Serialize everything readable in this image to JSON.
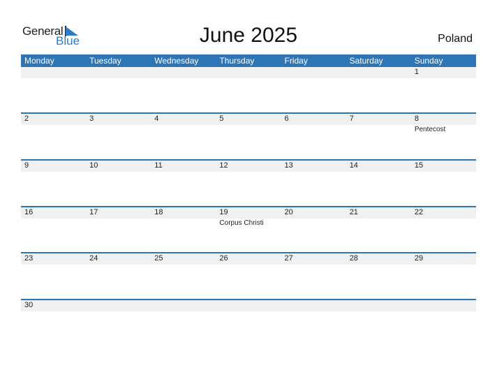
{
  "logo": {
    "text1": "General",
    "text2": "Blue"
  },
  "title": "June 2025",
  "country": "Poland",
  "colors": {
    "accent": "#2e75b6",
    "strip": "#f0f0f0"
  },
  "weekdays": [
    "Monday",
    "Tuesday",
    "Wednesday",
    "Thursday",
    "Friday",
    "Saturday",
    "Sunday"
  ],
  "weeks": [
    [
      {
        "d": ""
      },
      {
        "d": ""
      },
      {
        "d": ""
      },
      {
        "d": ""
      },
      {
        "d": ""
      },
      {
        "d": ""
      },
      {
        "d": "1"
      }
    ],
    [
      {
        "d": "2"
      },
      {
        "d": "3"
      },
      {
        "d": "4"
      },
      {
        "d": "5"
      },
      {
        "d": "6"
      },
      {
        "d": "7"
      },
      {
        "d": "8",
        "e": "Pentecost"
      }
    ],
    [
      {
        "d": "9"
      },
      {
        "d": "10"
      },
      {
        "d": "11"
      },
      {
        "d": "12"
      },
      {
        "d": "13"
      },
      {
        "d": "14"
      },
      {
        "d": "15"
      }
    ],
    [
      {
        "d": "16"
      },
      {
        "d": "17"
      },
      {
        "d": "18"
      },
      {
        "d": "19",
        "e": "Corpus Christi"
      },
      {
        "d": "20"
      },
      {
        "d": "21"
      },
      {
        "d": "22"
      }
    ],
    [
      {
        "d": "23"
      },
      {
        "d": "24"
      },
      {
        "d": "25"
      },
      {
        "d": "26"
      },
      {
        "d": "27"
      },
      {
        "d": "28"
      },
      {
        "d": "29"
      }
    ],
    [
      {
        "d": "30"
      },
      {
        "d": ""
      },
      {
        "d": ""
      },
      {
        "d": ""
      },
      {
        "d": ""
      },
      {
        "d": ""
      },
      {
        "d": ""
      }
    ]
  ]
}
